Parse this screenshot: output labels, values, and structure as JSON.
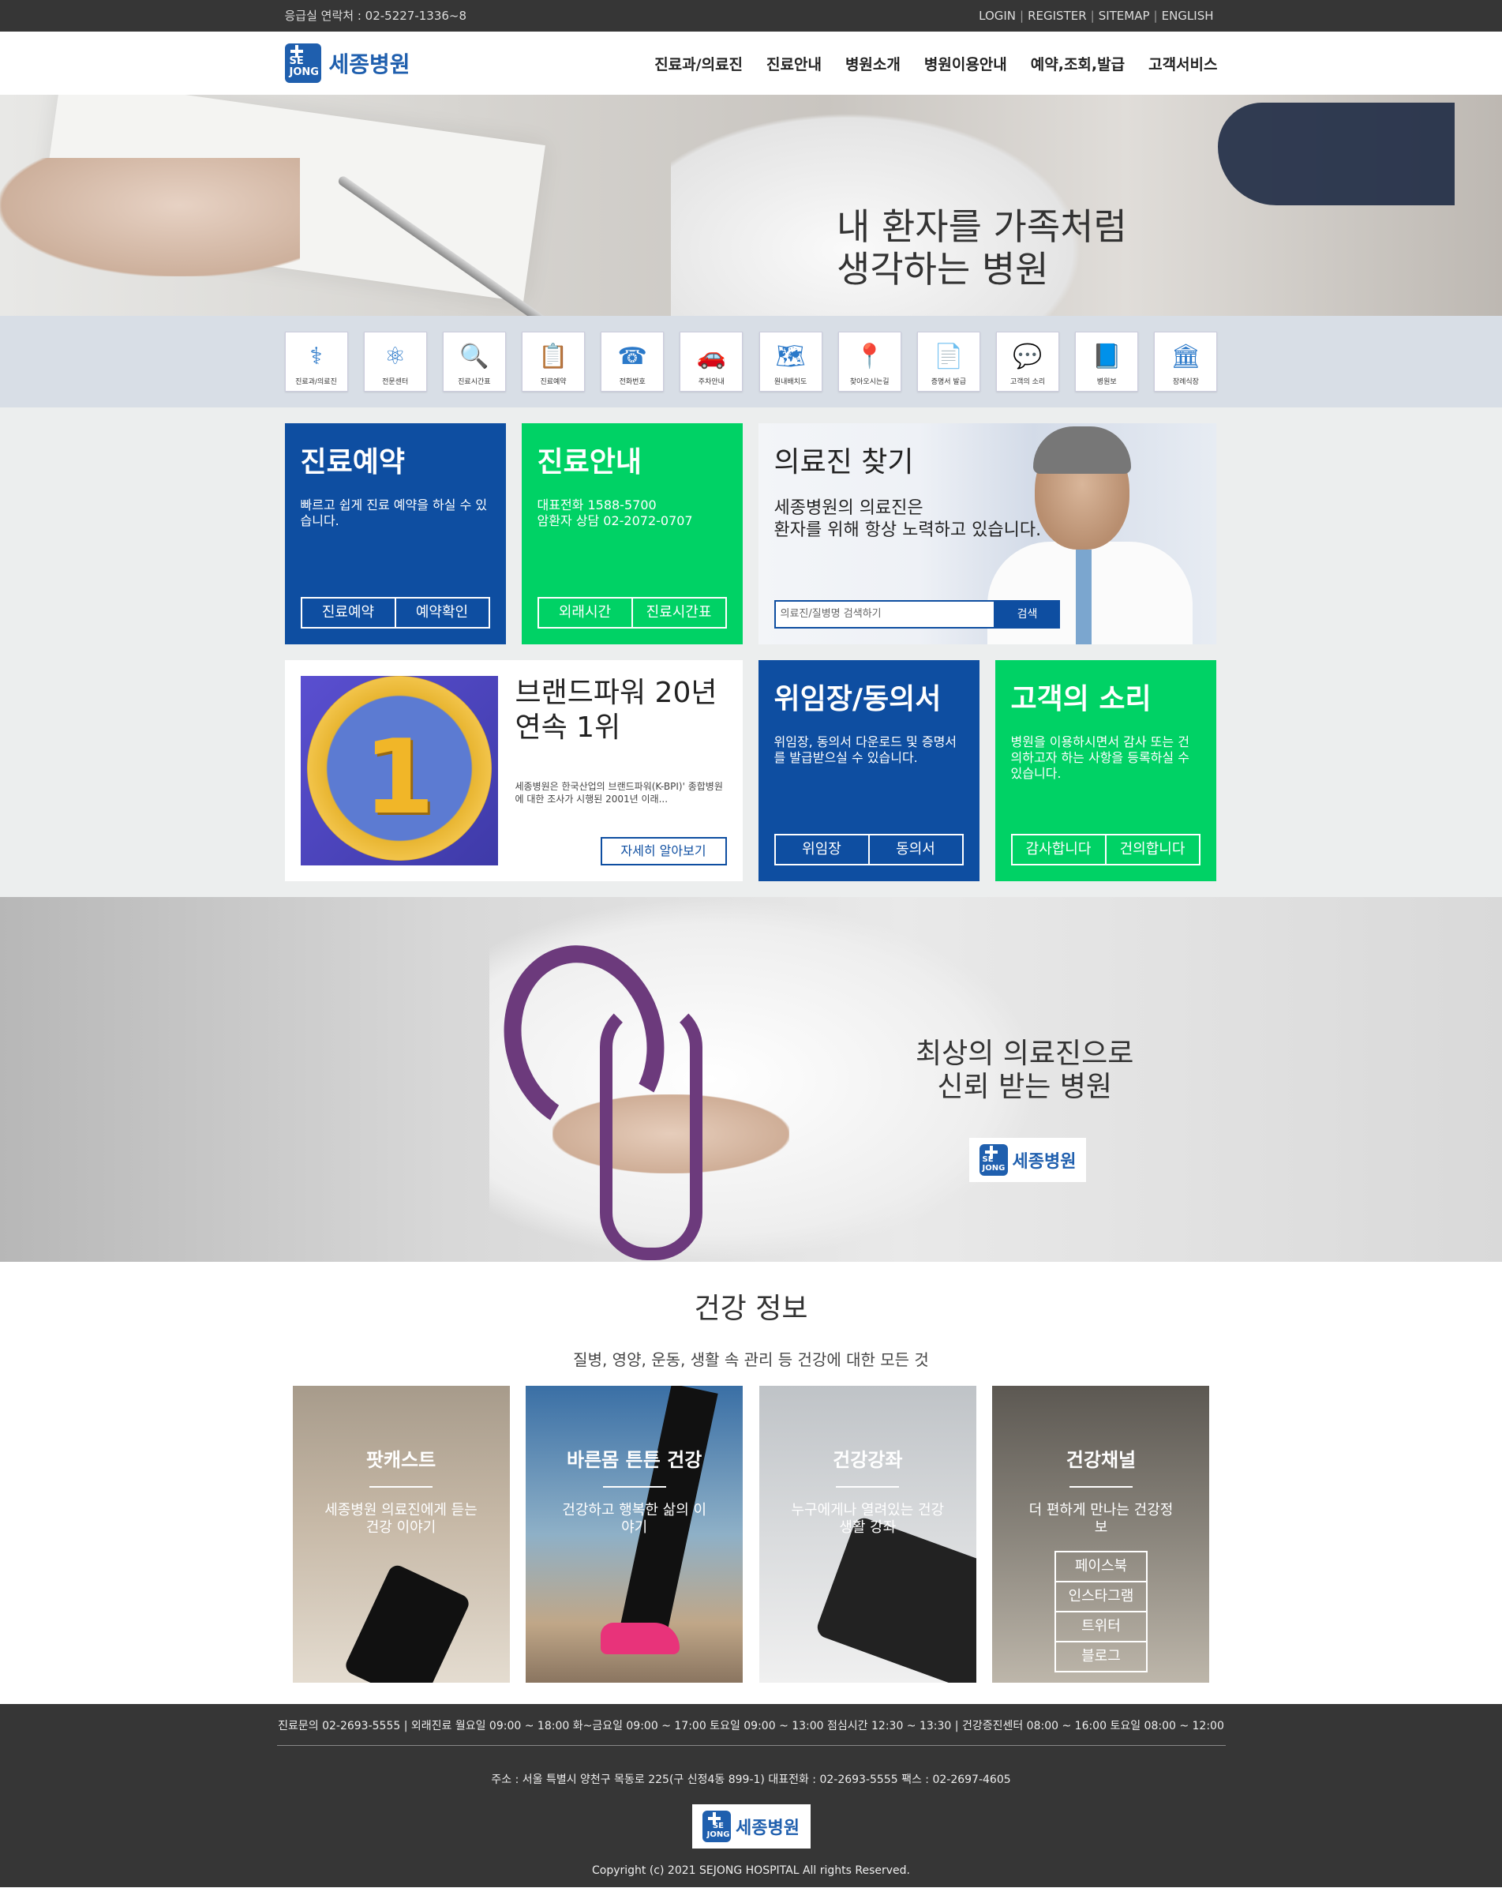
{
  "topbar": {
    "emergency": "응급실 연락처 : 02-5227-1336~8",
    "links": [
      "LOGIN",
      "REGISTER",
      "SITEMAP",
      "ENGLISH"
    ]
  },
  "header": {
    "logo_mark": "SE JONG",
    "logo_text": "세종병원",
    "nav": [
      "진료과/의료진",
      "진료안내",
      "병원소개",
      "병원이용안내",
      "예약,조회,발급",
      "고객서비스"
    ]
  },
  "hero": {
    "line1": "내 환자를 가족처럼",
    "line2": "생각하는 병원"
  },
  "quick": [
    {
      "label": "진료과/의료진",
      "icon": "stethoscope-icon"
    },
    {
      "label": "전문센터",
      "icon": "molecule-icon"
    },
    {
      "label": "진료시간표",
      "icon": "magnifier-doc-icon"
    },
    {
      "label": "진료예약",
      "icon": "clipboard-icon"
    },
    {
      "label": "전화번호",
      "icon": "phone-book-icon"
    },
    {
      "label": "주차안내",
      "icon": "car-icon"
    },
    {
      "label": "원내배치도",
      "icon": "map-fold-icon"
    },
    {
      "label": "찾아오시는길",
      "icon": "location-icon"
    },
    {
      "label": "증명서 발급",
      "icon": "document-icon"
    },
    {
      "label": "고객의 소리",
      "icon": "chat-bubble-icon"
    },
    {
      "label": "병원보",
      "icon": "book-icon"
    },
    {
      "label": "장례식장",
      "icon": "building-icon"
    }
  ],
  "reserve": {
    "title": "진료예약",
    "desc": "빠르고 쉽게 진료 예약을 하실 수 있습니다.",
    "btn1": "진료예약",
    "btn2": "예약확인"
  },
  "guide": {
    "title": "진료안내",
    "phone1": "대표전화 1588-5700",
    "phone2": "암환자 상담 02-2072-0707",
    "btn1": "외래시간",
    "btn2": "진료시간표"
  },
  "doctor": {
    "title": "의료진 찾기",
    "line1": "세종병원의 의료진은",
    "line2": "환자를 위해 항상 노력하고 있습니다.",
    "placeholder": "의료진/질병명 검색하기",
    "search_btn": "검색"
  },
  "brand": {
    "badge_number": "1",
    "title1": "브랜드파워 20년",
    "title2": "연속 1위",
    "desc": "세종병원은 한국산업의 브랜드파워(K-BPI)' 종합병원에 대한 조사가 시행된 2001년 이래...",
    "more": "자세히 알아보기"
  },
  "consent": {
    "title": "위임장/동의서",
    "desc": "위임장, 동의서 다운로드 및 증명서를 발급받으실 수 있습니다.",
    "btn1": "위임장",
    "btn2": "동의서"
  },
  "voice": {
    "title": "고객의 소리",
    "desc": "병원을 이용하시면서 감사 또는 건의하고자 하는 사항을 등록하실 수 있습니다.",
    "btn1": "감사합니다",
    "btn2": "건의합니다"
  },
  "promo": {
    "line1": "최상의 의료진으로",
    "line2": "신뢰 받는 병원",
    "logo_mark": "SE JONG",
    "logo_text": "세종병원"
  },
  "health": {
    "title": "건강 정보",
    "sub": "질병, 영양, 운동, 생활 속 관리 등 건강에 대한 모든 것",
    "cards": [
      {
        "title": "팟캐스트",
        "desc": "세종병원 의료진에게 듣는 건강 이야기"
      },
      {
        "title": "바른몸 튼튼 건강",
        "desc": "건강하고 행복한 삶의 이야기"
      },
      {
        "title": "건강강좌",
        "desc": "누구에게나 열려있는 건강 생활 강좌"
      },
      {
        "title": "건강채널",
        "desc": "더 편하게 만나는 건강정보"
      }
    ],
    "social": [
      "페이스북",
      "인스타그램",
      "트위터",
      "블로그"
    ]
  },
  "footer": {
    "hours": "진료문의 02-2693-5555 | 외래진료 월요일 09:00 ~ 18:00 화~금요일 09:00 ~ 17:00 토요일 09:00 ~ 13:00 점심시간 12:30 ~ 13:30 | 건강증진센터 08:00 ~ 16:00 토요일 08:00 ~ 12:00",
    "address": "주소 : 서울 특별시 양천구 목동로 225(구 신정4동 899-1) 대표전화 : 02-2693-5555 팩스 : 02-2697-4605",
    "logo_mark": "SE JONG",
    "logo_text": "세종병원",
    "copyright": "Copyright (c) 2021 SEJONG HOSPITAL All rights Reserved."
  },
  "colors": {
    "primary_blue": "#0e4ea1",
    "accent_green": "#00d265",
    "dark_bar": "#363636"
  }
}
